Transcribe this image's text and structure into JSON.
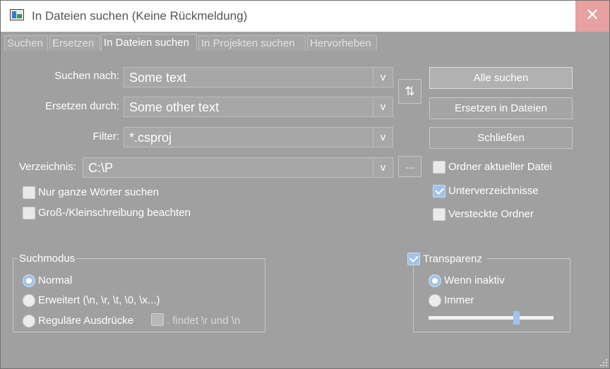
{
  "window": {
    "title": "In Dateien suchen (Keine Rückmeldung)"
  },
  "tabs": [
    "Suchen",
    "Ersetzen",
    "In Dateien suchen",
    "In Projekten suchen",
    "Hervorheben"
  ],
  "active_tab": "In Dateien suchen",
  "fields": {
    "search": {
      "label": "Suchen nach:",
      "value": "Some text"
    },
    "replace": {
      "label": "Ersetzen durch:",
      "value": "Some other text"
    },
    "filter": {
      "label": "Filter:",
      "value": "*.csproj"
    },
    "directory": {
      "label": "Verzeichnis:",
      "value": "C:\\P"
    }
  },
  "buttons": {
    "swap": "⇅",
    "find_all": "Alle suchen",
    "replace_in_files": "Ersetzen in Dateien",
    "close": "Schließen",
    "browse": "..."
  },
  "options": {
    "whole_words": {
      "label": "Nur ganze Wörter suchen",
      "checked": false
    },
    "match_case": {
      "label": "Groß-/Kleinschreibung beachten",
      "checked": false
    },
    "current_folder": {
      "label": "Ordner aktueller Datei",
      "checked": false
    },
    "subdirs": {
      "label": "Unterverzeichnisse",
      "checked": true
    },
    "hidden_folders": {
      "label": "Versteckte Ordner",
      "checked": false
    }
  },
  "search_mode": {
    "title": "Suchmodus",
    "normal": "Normal",
    "extended": "Erweitert (\\n, \\r, \\t, \\0, \\x...)",
    "regex": "Reguläre Ausdrücke",
    "dot_matches": ". findet \\r und \\n",
    "selected": "Normal"
  },
  "transparency": {
    "title": "Transparenz",
    "checked": true,
    "when_inactive": "Wenn inaktiv",
    "always": "Immer",
    "selected": "Wenn inaktiv",
    "level": 0.68
  }
}
